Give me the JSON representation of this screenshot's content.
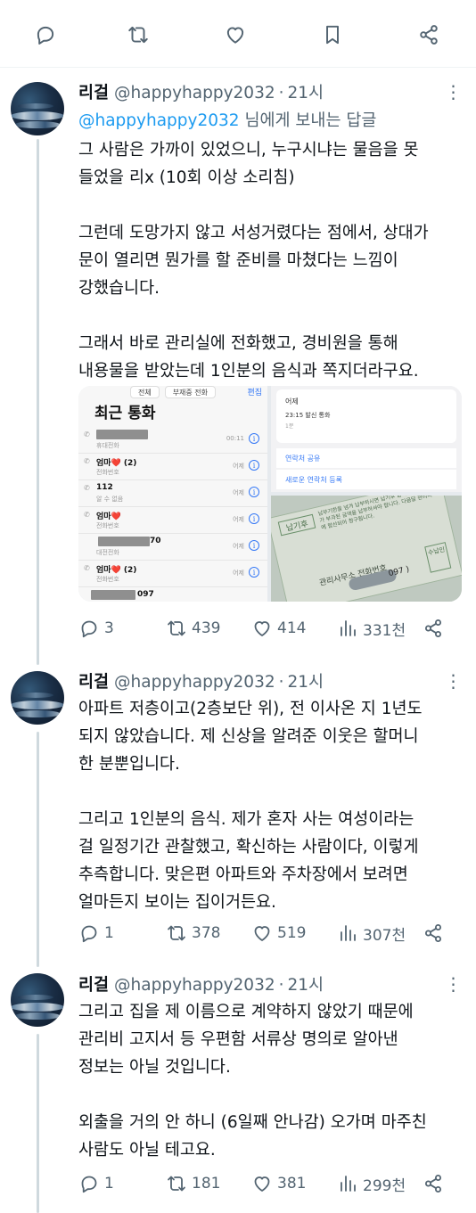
{
  "top_actions": [
    "reply-icon",
    "retweet-icon",
    "like-icon",
    "bookmark-icon",
    "share-icon"
  ],
  "tweets": [
    {
      "name": "리걸",
      "handle": "@happyhappy2032",
      "sep": "·",
      "time": "21시",
      "reply_to_handle": "@happyhappy2032",
      "reply_to_suffix": " 님에게 보내는 답글",
      "paragraphs": [
        [
          "그 사람은 가까이 있었으니, 누구시냐는 물음을 못",
          "들었을 리x (10회 이상 소리침)"
        ],
        [
          "그런데 도망가지 않고 서성거렸다는 점에서, 상대가",
          "문이 열리면 뭔가를 할 준비를 마쳤다는 느낌이",
          "강했습니다."
        ],
        [
          "그래서 바로 관리실에 전화했고, 경비원을 통해",
          "내용물을 받았는데 1인분의 음식과 쪽지더라구요."
        ]
      ],
      "replies": "3",
      "retweets": "439",
      "likes": "414",
      "views": "331천"
    },
    {
      "name": "리걸",
      "handle": "@happyhappy2032",
      "sep": "·",
      "time": "21시",
      "paragraphs": [
        [
          "아파트 저층이고(2층보단 위), 전 이사온 지 1년도",
          "되지 않았습니다. 제 신상을 알려준 이웃은 할머니",
          "한 분뿐입니다."
        ],
        [
          "그리고 1인분의 음식. 제가 혼자 사는 여성이라는",
          "걸 일정기간 관찰했고, 확신하는 사람이다, 이렇게",
          "추측합니다. 맞은편 아파트와 주차장에서 보려면",
          "얼마든지 보이는 집이거든요."
        ]
      ],
      "replies": "1",
      "retweets": "378",
      "likes": "519",
      "views": "307천"
    },
    {
      "name": "리걸",
      "handle": "@happyhappy2032",
      "sep": "·",
      "time": "21시",
      "paragraphs": [
        [
          "그리고 집을 제 이름으로 계약하지 않았기 때문에",
          "관리비 고지서 등 우편함 서류상 명의로 알아낸",
          "정보는 아닐 것입니다."
        ],
        [
          "외출을 거의 안 하니 (6일째 안나감) 오가며 마주친",
          "사람도 아닐 테고요."
        ]
      ],
      "replies": "1",
      "retweets": "181",
      "likes": "381",
      "views": "299천"
    }
  ],
  "media": {
    "recent_calls": {
      "tabs": [
        "전체",
        "부재중 전화"
      ],
      "edit": "편집",
      "title": "최근 통화",
      "rows": [
        {
          "main": "",
          "suffix": "",
          "sub": "휴대전화",
          "right": "00:11",
          "blur": true
        },
        {
          "main": "엄마",
          "heart": "❤️",
          "count": " (2)",
          "sub": "전화번호",
          "right": "어제"
        },
        {
          "main": "112",
          "sub": "알 수 없음",
          "right": "어제"
        },
        {
          "main": "엄마",
          "heart": "❤️",
          "count": "",
          "sub": "전화번호",
          "right": "어제"
        },
        {
          "main": "",
          "suffix": "70",
          "sub": "대전전화",
          "right": "어제",
          "blur": true
        },
        {
          "main": "엄마",
          "heart": "❤️",
          "count": " (2)",
          "sub": "전화번호",
          "right": "어제"
        },
        {
          "main": "",
          "suffix": "097",
          "sub": "",
          "right": "",
          "blur": true
        }
      ]
    },
    "call_detail": {
      "date": "어제",
      "line": "23:15  발신 통화",
      "line2": "1분",
      "link1": "연락처 공유",
      "link2": "새로운 연락처 등록"
    },
    "paper": {
      "tag": "납기후",
      "text": "납부기한을 넘겨 납부하시면 납기후 금액을 연체료가 부과된 금액을 납부하셔야 합니다. 다음달 관리비에 합산되어 청구됩니다.",
      "label": "관리사무소 전화번호",
      "number": "097 )",
      "stamp": "수납인"
    }
  },
  "colors": {
    "text": "#0f1419",
    "secondary": "#536471",
    "link": "#1d9bf0",
    "thread_line": "#cfd9de"
  }
}
